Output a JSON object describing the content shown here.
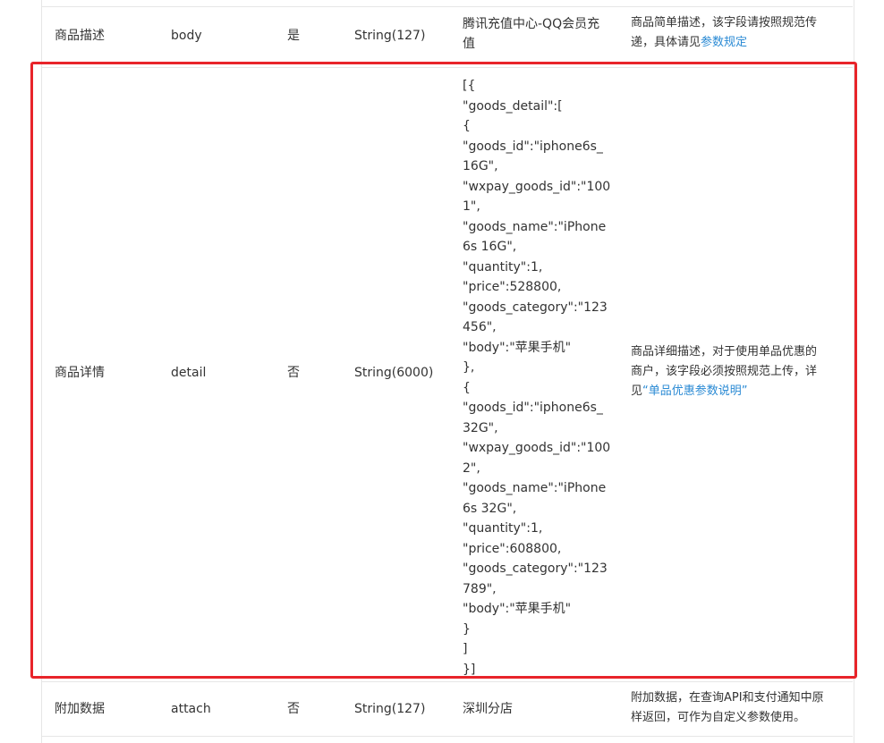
{
  "rows": [
    {
      "name": "商品描述",
      "field": "body",
      "required": "是",
      "type": "String(127)",
      "example": [
        "腾讯充值中心-QQ会员充",
        "值"
      ],
      "desc_text_1": "商品简单描述，该字段请按照规范传",
      "desc_text_2": "递，具体请见",
      "desc_link": "参数规定"
    },
    {
      "name": "商品详情",
      "field": "detail",
      "required": "否",
      "type": "String(6000)",
      "example": [
        "[{",
        "\"goods_detail\":[",
        "{",
        "\"goods_id\":\"iphone6s_",
        "16G\",",
        "\"wxpay_goods_id\":\"100",
        "1\",",
        "\"goods_name\":\"iPhone",
        "6s 16G\",",
        "\"quantity\":1,",
        "\"price\":528800,",
        "\"goods_category\":\"123",
        "456\",",
        "\"body\":\"苹果手机\"",
        "},",
        "{",
        "\"goods_id\":\"iphone6s_",
        "32G\",",
        "\"wxpay_goods_id\":\"100",
        "2\",",
        "\"goods_name\":\"iPhone",
        "6s 32G\",",
        "\"quantity\":1,",
        "\"price\":608800,",
        "\"goods_category\":\"123",
        "789\",",
        "\"body\":\"苹果手机\"",
        "}",
        "]",
        "}]"
      ],
      "desc_text_1": "商品详细描述，对于使用单品优惠的",
      "desc_text_2": "商户，该字段必须按照规范上传，详",
      "desc_text_3": "见",
      "desc_link": "“单品优惠参数说明”"
    },
    {
      "name": "附加数据",
      "field": "attach",
      "required": "否",
      "type": "String(127)",
      "example_text": "深圳分店",
      "desc_text_1": "附加数据，在查询API和支付通知中原",
      "desc_text_2": "样返回，可作为自定义参数使用。"
    }
  ],
  "colors": {
    "highlight": "#e8242a",
    "link": "#2a8ad4",
    "border": "#e6e6e6"
  }
}
